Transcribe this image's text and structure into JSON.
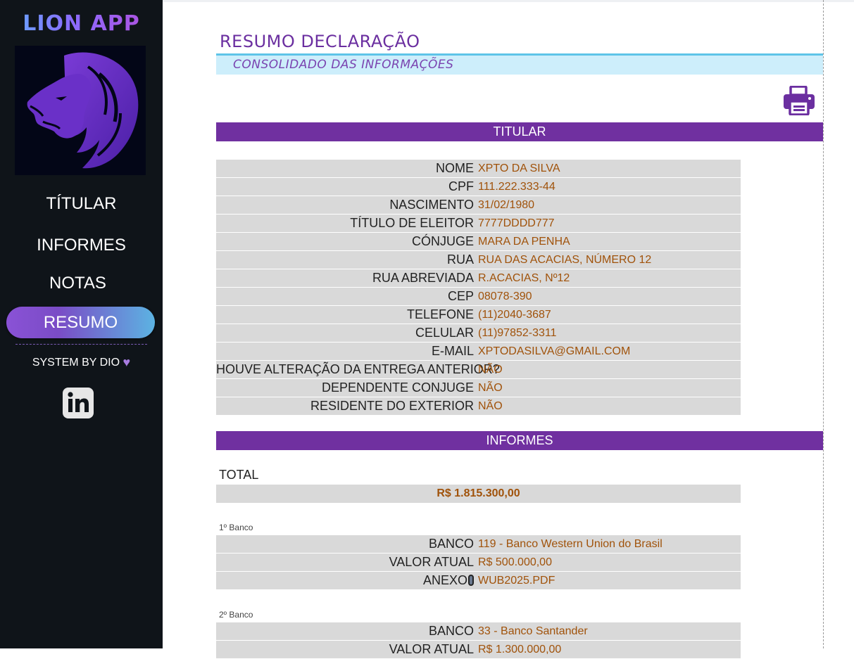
{
  "app": {
    "title": "LION APP"
  },
  "sidebar": {
    "items": [
      {
        "label": "TÍTULAR"
      },
      {
        "label": "INFORMES"
      },
      {
        "label": "NOTAS"
      },
      {
        "label": "RESUMO",
        "active": true
      }
    ],
    "system_by": "SYSTEM BY DIO",
    "heart_icon": "heart-icon",
    "linkedin_icon": "linkedin-icon"
  },
  "colors": {
    "sidebar_bg": "#0f1419",
    "accent_purple": "#7030a0",
    "value_text": "#a0520a",
    "subtitle_band": "#cdeefb",
    "title_rule": "#5ec4e8",
    "row_bg": "#d9d9d9"
  },
  "header": {
    "title": "RESUMO DECLARAÇÃO",
    "subtitle": "CONSOLIDADO DAS INFORMAÇÕES",
    "print_icon": "printer-icon"
  },
  "titular": {
    "section_title": "TITULAR",
    "rows": [
      {
        "label": "NOME",
        "value": "XPTO DA SILVA"
      },
      {
        "label": "CPF",
        "value": "111.222.333-44"
      },
      {
        "label": "NASCIMENTO",
        "value": "31/02/1980"
      },
      {
        "label": "TÍTULO DE ELEITOR",
        "value": "7777DDDD777"
      },
      {
        "label": "CÓNJUGE",
        "value": "MARA DA PENHA"
      },
      {
        "label": "RUA",
        "value": "RUA DAS ACACIAS, NÚMERO 12"
      },
      {
        "label": "RUA ABREVIADA",
        "value": "R.ACACIAS, Nº12"
      },
      {
        "label": "CEP",
        "value": "08078-390"
      },
      {
        "label": "TELEFONE",
        "value": "(11)2040-3687"
      },
      {
        "label": "CELULAR",
        "value": "(11)97852-3311"
      },
      {
        "label": "E-MAIL",
        "value": "XPTODASILVA@GMAIL.COM"
      },
      {
        "label": "HOUVE ALTERAÇÃO DA ENTREGA ANTERIOR?",
        "value": "NÃO"
      },
      {
        "label": "DEPENDENTE CONJUGE",
        "value": "NÃO"
      },
      {
        "label": "RESIDENTE DO EXTERIOR",
        "value": "NÃO"
      }
    ]
  },
  "informes": {
    "section_title": "INFORMES",
    "total_label": "TOTAL",
    "total_value": "R$ 1.815.300,00",
    "banks": [
      {
        "caption": "1º Banco",
        "rows": [
          {
            "label": "BANCO",
            "value": "119 - Banco Western Union do Brasil"
          },
          {
            "label": "VALOR ATUAL",
            "value": "R$ 500.000,00"
          },
          {
            "label": "ANEXO",
            "value": "WUB2025.PDF",
            "attachment_icon": "paperclip-icon"
          }
        ]
      },
      {
        "caption": "2º Banco",
        "rows": [
          {
            "label": "BANCO",
            "value": "33 - Banco Santander"
          },
          {
            "label": "VALOR ATUAL",
            "value": "R$ 1.300.000,00"
          }
        ]
      }
    ]
  }
}
